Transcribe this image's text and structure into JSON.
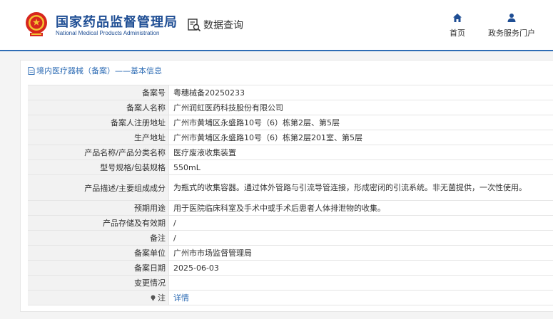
{
  "header": {
    "org_name_cn": "国家药品监督管理局",
    "org_name_en": "National Medical Products Administration",
    "data_query_label": "数据查询",
    "nav": [
      {
        "label": "首页",
        "icon": "home-icon"
      },
      {
        "label": "政务服务门户",
        "icon": "user-icon"
      }
    ]
  },
  "breadcrumb": "境内医疗器械（备案）——基本信息",
  "rows": [
    {
      "label": "备案号",
      "value": "粤穗械备20250233"
    },
    {
      "label": "备案人名称",
      "value": "广州润虹医药科技股份有限公司"
    },
    {
      "label": "备案人注册地址",
      "value": "广州市黄埔区永盛路10号（6）栋第2层、第5层"
    },
    {
      "label": "生产地址",
      "value": "广州市黄埔区永盛路10号（6）栋第2层201室、第5层"
    },
    {
      "label": "产品名称/产品分类名称",
      "value": "医疗废液收集装置"
    },
    {
      "label": "型号规格/包装规格",
      "value": "550mL"
    },
    {
      "label": "产品描述/主要组成成分",
      "value": "为瓶式的收集容器。通过体外管路与引流导管连接，形成密闭的引流系统。非无菌提供，一次性使用。"
    },
    {
      "label": "预期用途",
      "value": "用于医院临床科室及手术中或手术后患者人体排泄物的收集。"
    },
    {
      "label": "产品存储及有效期",
      "value": "/"
    },
    {
      "label": "备注",
      "value": "/"
    },
    {
      "label": "备案单位",
      "value": "广州市市场监督管理局"
    },
    {
      "label": "备案日期",
      "value": "2025-06-03"
    },
    {
      "label": "变更情况",
      "value": ""
    },
    {
      "label": "注",
      "value": "详情",
      "icon": "note-icon"
    }
  ],
  "colors": {
    "brand_blue": "#1f4e94",
    "link_blue": "#2f6db5",
    "label_bg": "#f2f2f2"
  }
}
